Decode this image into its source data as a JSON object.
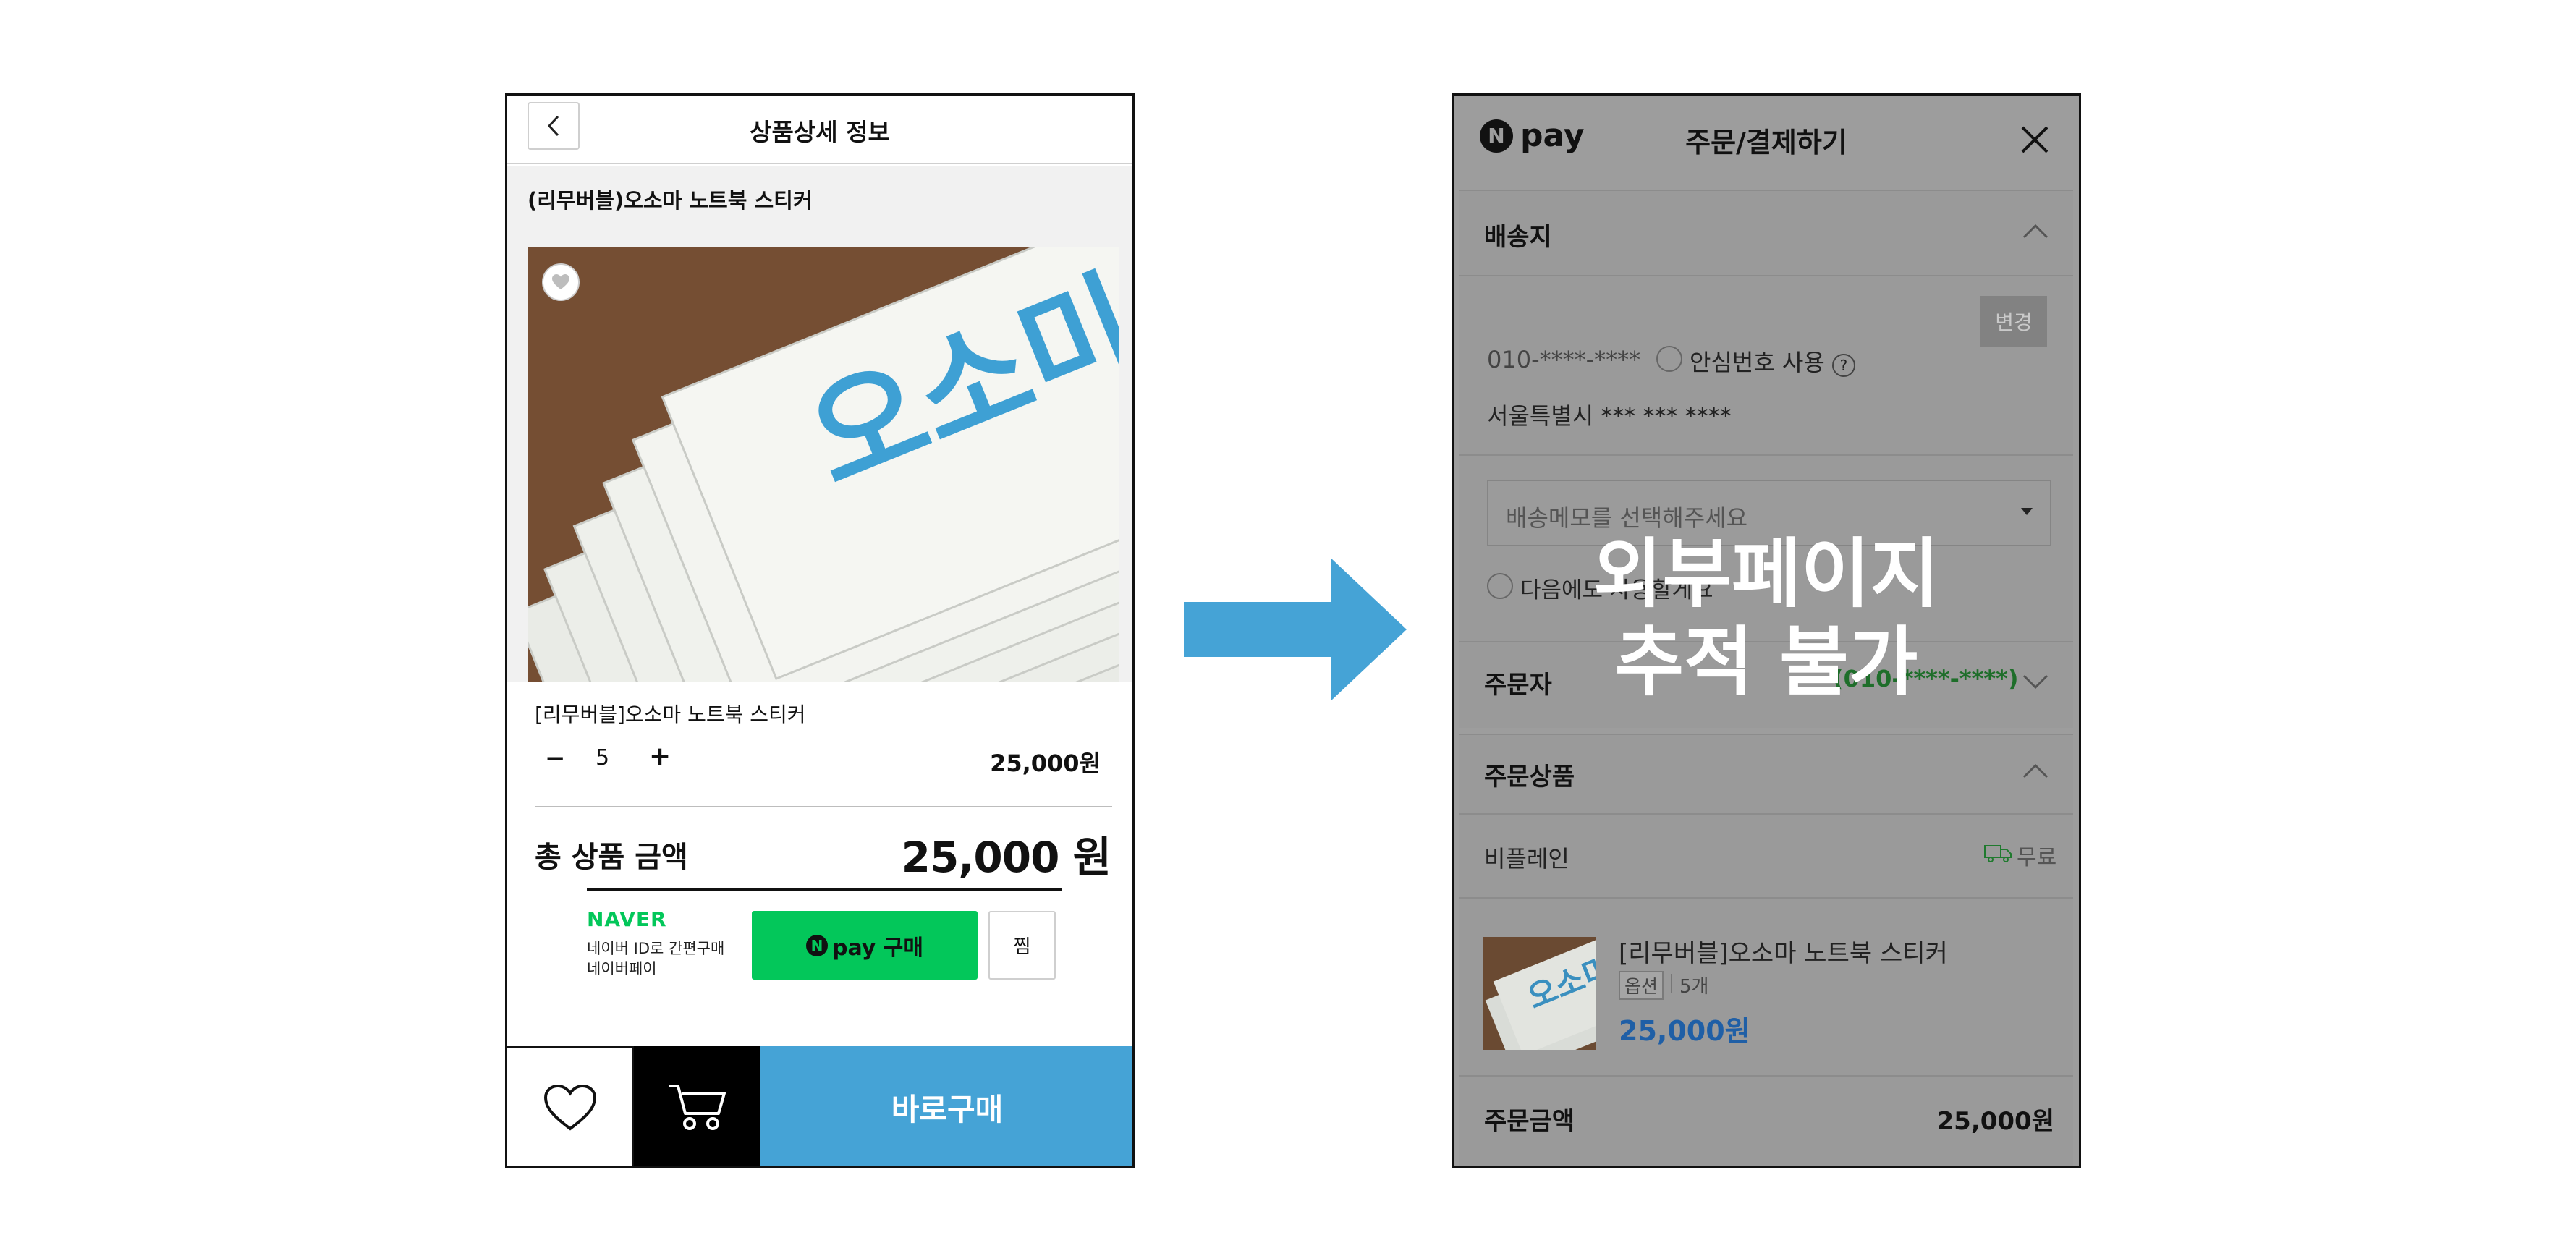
{
  "left": {
    "header_title": "상품상세 정보",
    "product_heading": "(리무버블)오소마 노트북 스티커",
    "option_name": "[리무버블]오소마 노트북 스티커",
    "qty_minus": "−",
    "quantity": "5",
    "qty_plus": "+",
    "option_price": "25,000원",
    "total_label": "총 상품 금액",
    "total_value": "25,000 원",
    "naver_logo": "NAVER",
    "naver_sub1": "네이버 ID로 간편구매",
    "naver_sub2": "네이버페이",
    "npay_button": "pay 구매",
    "jjim_button": "찜",
    "buy_now": "바로구매",
    "sticker_text": "오소미"
  },
  "right": {
    "npay_logo": "pay",
    "title": "주문/결제하기",
    "shipping_title": "배송지",
    "change_button": "변경",
    "phone_masked": "010-****-****",
    "safe_number": "안심번호 사용",
    "address": "서울특별시 *** *** ****",
    "memo_placeholder": "배송메모를 선택해주세요",
    "next_use": "다음에도 사용할게요",
    "orderer_title": "주문자",
    "orderer_phone": "(010-****-****)",
    "products_title": "주문상품",
    "seller": "비플레인",
    "shipping_fee": "무료",
    "item_name": "[리무버블]오소마 노트북 스티커",
    "option_tag": "옵션",
    "item_qty": "5개",
    "item_price": "25,000원",
    "order_amount_label": "주문금액",
    "order_amount_value": "25,000원",
    "overlay_line1": "외부페이지",
    "overlay_line2": "추적 불가"
  },
  "colors": {
    "arrow": "#45a3d6",
    "npay_green": "#03c75a",
    "buy_now_blue": "#45a3d6",
    "overlay_gray": "#9d9d9d"
  }
}
